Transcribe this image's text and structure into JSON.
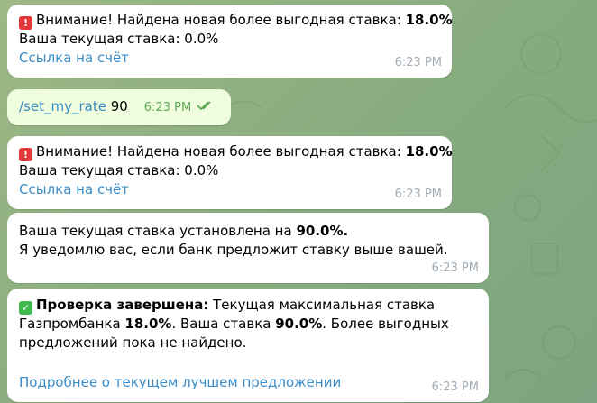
{
  "messages": [
    {
      "alert_icon": "rotating-light-icon",
      "alert_prefix": "Внимание! Найдена новая более выгодная ставка: ",
      "alert_rate": "18.0%",
      "current_rate_text": "Ваша текущая ставка: 0.0%",
      "link": "Ссылка на счёт",
      "time": "6:23 PM"
    },
    {
      "command": "/set_my_rate",
      "argument": " 90",
      "time": "6:23 PM",
      "status_icon": "double-check-icon"
    },
    {
      "alert_icon": "rotating-light-icon",
      "alert_prefix": "Внимание! Найдена новая более выгодная ставка: ",
      "alert_rate": "18.0%",
      "current_rate_text": "Ваша текущая ставка: 0.0%",
      "link": "Ссылка на счёт",
      "time": "6:23 PM"
    },
    {
      "line1_prefix": "Ваша текущая ставка установлена на ",
      "line1_rate": "90.0%.",
      "line2": "Я уведомлю вас, если банк предложит ставку выше вашей.",
      "time": "6:23 PM"
    },
    {
      "check_icon": "check-mark-button-icon",
      "title": "Проверка завершена:",
      "text1": " Текущая максимальная ставка",
      "text2_prefix": "Газпромбанка ",
      "text2_rate": "18.0%",
      "text2_mid": ". Ваша ставка ",
      "text2_user_rate": "90.0%",
      "text2_suffix": ". Более выгодных",
      "text3": "предложений пока не найдено.",
      "link": "Подробнее о текущем лучшем предложении",
      "time": "6:23 PM"
    }
  ],
  "colors": {
    "incoming_bg": "#ffffff",
    "outgoing_bg": "#effdde",
    "link": "#3a8cc6",
    "time_in": "#a0acb6",
    "time_out": "#5fa954",
    "chat_bg": "#8fb07f"
  }
}
